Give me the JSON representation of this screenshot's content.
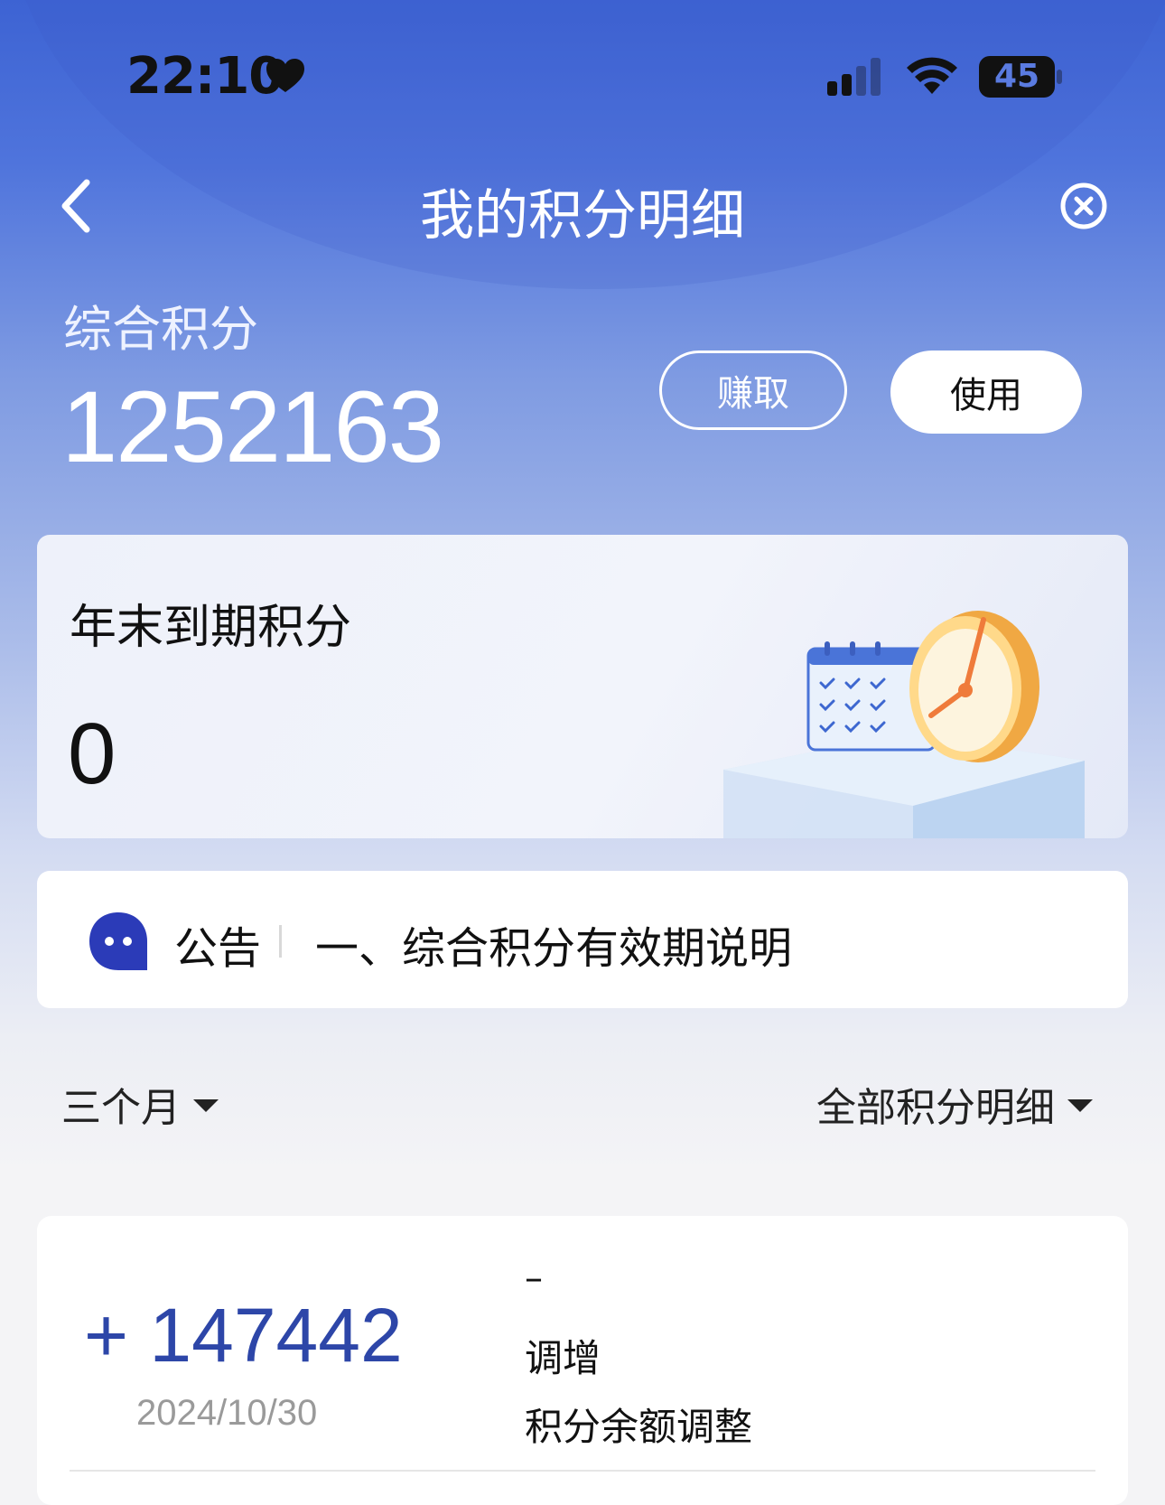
{
  "status_bar": {
    "time": "22:10",
    "battery": "45"
  },
  "nav": {
    "title": "我的积分明细"
  },
  "summary": {
    "label": "综合积分",
    "value": "1252163",
    "earn_label": "赚取",
    "use_label": "使用"
  },
  "expire_card": {
    "title": "年末到期积分",
    "value": "0"
  },
  "notice": {
    "label": "公告",
    "text": "一、综合积分有效期说明"
  },
  "filters": {
    "period": "三个月",
    "category": "全部积分明细"
  },
  "records": [
    {
      "amount": "+ 147442",
      "date": "2024/10/30",
      "dash": "–",
      "type": "调增",
      "description": "积分余额调整"
    }
  ],
  "colors": {
    "header_top": "#3d63d3",
    "amount_blue": "#2d46a8",
    "notice_icon": "#2b3bb8"
  }
}
